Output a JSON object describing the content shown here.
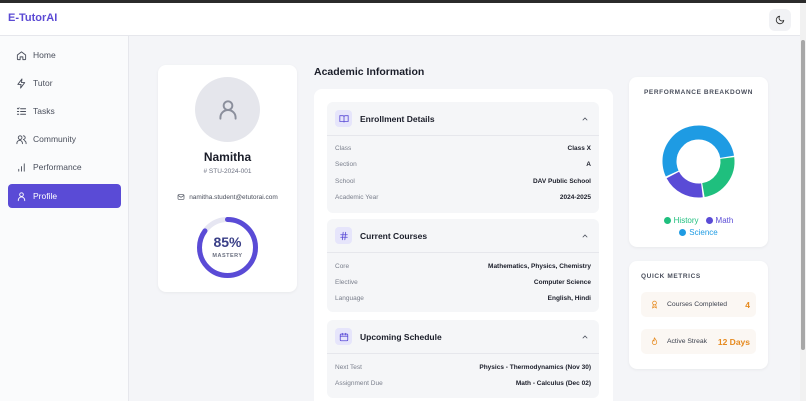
{
  "app": {
    "brand": "E-TutorAI",
    "theme_toggle_icon": "moon-icon"
  },
  "sidebar": {
    "items": [
      {
        "label": "Home",
        "icon": "home-icon",
        "active": false
      },
      {
        "label": "Tutor",
        "icon": "bolt-icon",
        "active": false
      },
      {
        "label": "Tasks",
        "icon": "list-icon",
        "active": false
      },
      {
        "label": "Community",
        "icon": "users-icon",
        "active": false
      },
      {
        "label": "Performance",
        "icon": "chart-icon",
        "active": false
      },
      {
        "label": "Profile",
        "icon": "user-icon",
        "active": true
      }
    ]
  },
  "profile": {
    "name": "Namitha",
    "student_id": "# STU-2024-001",
    "email": "namitha.student@etutorai.com",
    "mastery_value": "85%",
    "mastery_label": "MASTERY",
    "mastery_fraction": 0.85
  },
  "academic": {
    "title": "Academic Information",
    "enrollment": {
      "title": "Enrollment Details",
      "rows": [
        {
          "key": "Class",
          "value": "Class X"
        },
        {
          "key": "Section",
          "value": "A"
        },
        {
          "key": "School",
          "value": "DAV Public School"
        },
        {
          "key": "Academic Year",
          "value": "2024-2025"
        }
      ]
    },
    "courses": {
      "title": "Current Courses",
      "rows": [
        {
          "key": "Core",
          "value": "Mathematics, Physics, Chemistry"
        },
        {
          "key": "Elective",
          "value": "Computer Science"
        },
        {
          "key": "Language",
          "value": "English, Hindi"
        }
      ]
    },
    "schedule": {
      "title": "Upcoming Schedule",
      "rows": [
        {
          "key": "Next Test",
          "value": "Physics - Thermodynamics (Nov 30)"
        },
        {
          "key": "Assignment Due",
          "value": "Math - Calculus (Dec 02)"
        }
      ]
    }
  },
  "performance": {
    "title": "PERFORMANCE BREAKDOWN",
    "legend": [
      {
        "name": "History",
        "color": "#1fbf7e"
      },
      {
        "name": "Math",
        "color": "#5a4bd6"
      },
      {
        "name": "Science",
        "color": "#1e9be3"
      }
    ]
  },
  "chart_data": {
    "type": "pie",
    "categories": [
      "History",
      "Math",
      "Science"
    ],
    "values": [
      25,
      20,
      55
    ],
    "colors": [
      "#1fbf7e",
      "#5a4bd6",
      "#1e9be3"
    ],
    "title": "PERFORMANCE BREAKDOWN"
  },
  "quick_metrics": {
    "title": "QUICK METRICS",
    "items": [
      {
        "label": "Courses Completed",
        "value": "4",
        "icon": "award-icon"
      },
      {
        "label": "Active Streak",
        "value": "12 Days",
        "icon": "flame-icon"
      }
    ]
  },
  "colors": {
    "accent": "#5a4bd6",
    "mastery_ring": "#5a4bd6",
    "metric_value": "#e68a1f"
  }
}
